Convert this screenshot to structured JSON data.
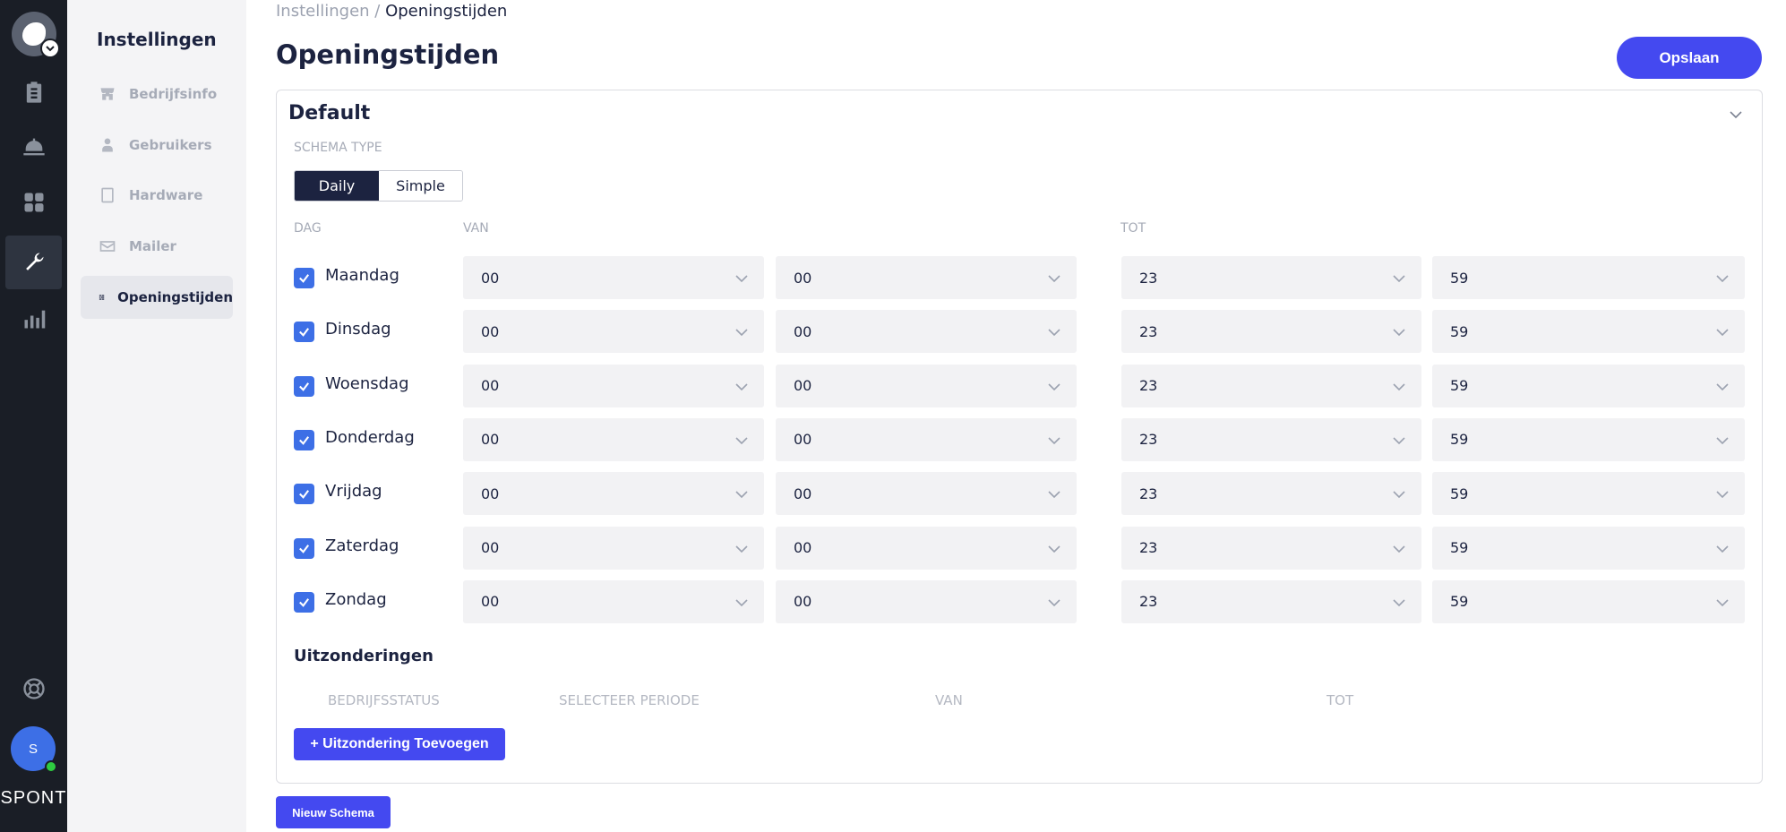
{
  "rail": {
    "brand": "SPONT",
    "avatar_initial": "S",
    "icons": [
      "clipboard-icon",
      "service-bell-icon",
      "grid-icon",
      "wrench-icon",
      "bar-chart-icon"
    ],
    "help_icon": "lifebuoy-icon"
  },
  "sidebar": {
    "title": "Instellingen",
    "items": [
      {
        "label": "Bedrijfsinfo",
        "icon": "store-icon",
        "active": false
      },
      {
        "label": "Gebruikers",
        "icon": "user-icon",
        "active": false
      },
      {
        "label": "Hardware",
        "icon": "tablet-icon",
        "active": false
      },
      {
        "label": "Mailer",
        "icon": "mail-icon",
        "active": false
      },
      {
        "label": "Openingstijden",
        "icon": "schedule-icon",
        "active": true
      }
    ]
  },
  "breadcrumb": {
    "parent": "Instellingen",
    "separator": " / ",
    "current": "Openingstijden"
  },
  "page": {
    "title": "Openingstijden",
    "save_label": "Opslaan"
  },
  "schedule": {
    "name": "Default",
    "schema_type_label": "SCHEMA TYPE",
    "schema_types": [
      "Daily",
      "Simple"
    ],
    "selected_type": "Daily",
    "columns": {
      "day": "DAG",
      "from": "VAN",
      "to": "TOT"
    },
    "days": [
      {
        "day": "Maandag",
        "checked": true,
        "from_h": "00",
        "from_m": "00",
        "to_h": "23",
        "to_m": "59"
      },
      {
        "day": "Dinsdag",
        "checked": true,
        "from_h": "00",
        "from_m": "00",
        "to_h": "23",
        "to_m": "59"
      },
      {
        "day": "Woensdag",
        "checked": true,
        "from_h": "00",
        "from_m": "00",
        "to_h": "23",
        "to_m": "59"
      },
      {
        "day": "Donderdag",
        "checked": true,
        "from_h": "00",
        "from_m": "00",
        "to_h": "23",
        "to_m": "59"
      },
      {
        "day": "Vrijdag",
        "checked": true,
        "from_h": "00",
        "from_m": "00",
        "to_h": "23",
        "to_m": "59"
      },
      {
        "day": "Zaterdag",
        "checked": true,
        "from_h": "00",
        "from_m": "00",
        "to_h": "23",
        "to_m": "59"
      },
      {
        "day": "Zondag",
        "checked": true,
        "from_h": "00",
        "from_m": "00",
        "to_h": "23",
        "to_m": "59"
      }
    ]
  },
  "exceptions": {
    "title": "Uitzonderingen",
    "headers": [
      "BEDRIJFSSTATUS",
      "SELECTEER PERIODE",
      "VAN",
      "TOT"
    ],
    "add_label": "+ Uitzondering Toevoegen"
  },
  "new_schema_label": "Nieuw Schema",
  "colors": {
    "accent": "#4449f0",
    "dark": "#1c2340",
    "checkbox": "#3d6fe6",
    "rail": "#1a1e26"
  }
}
